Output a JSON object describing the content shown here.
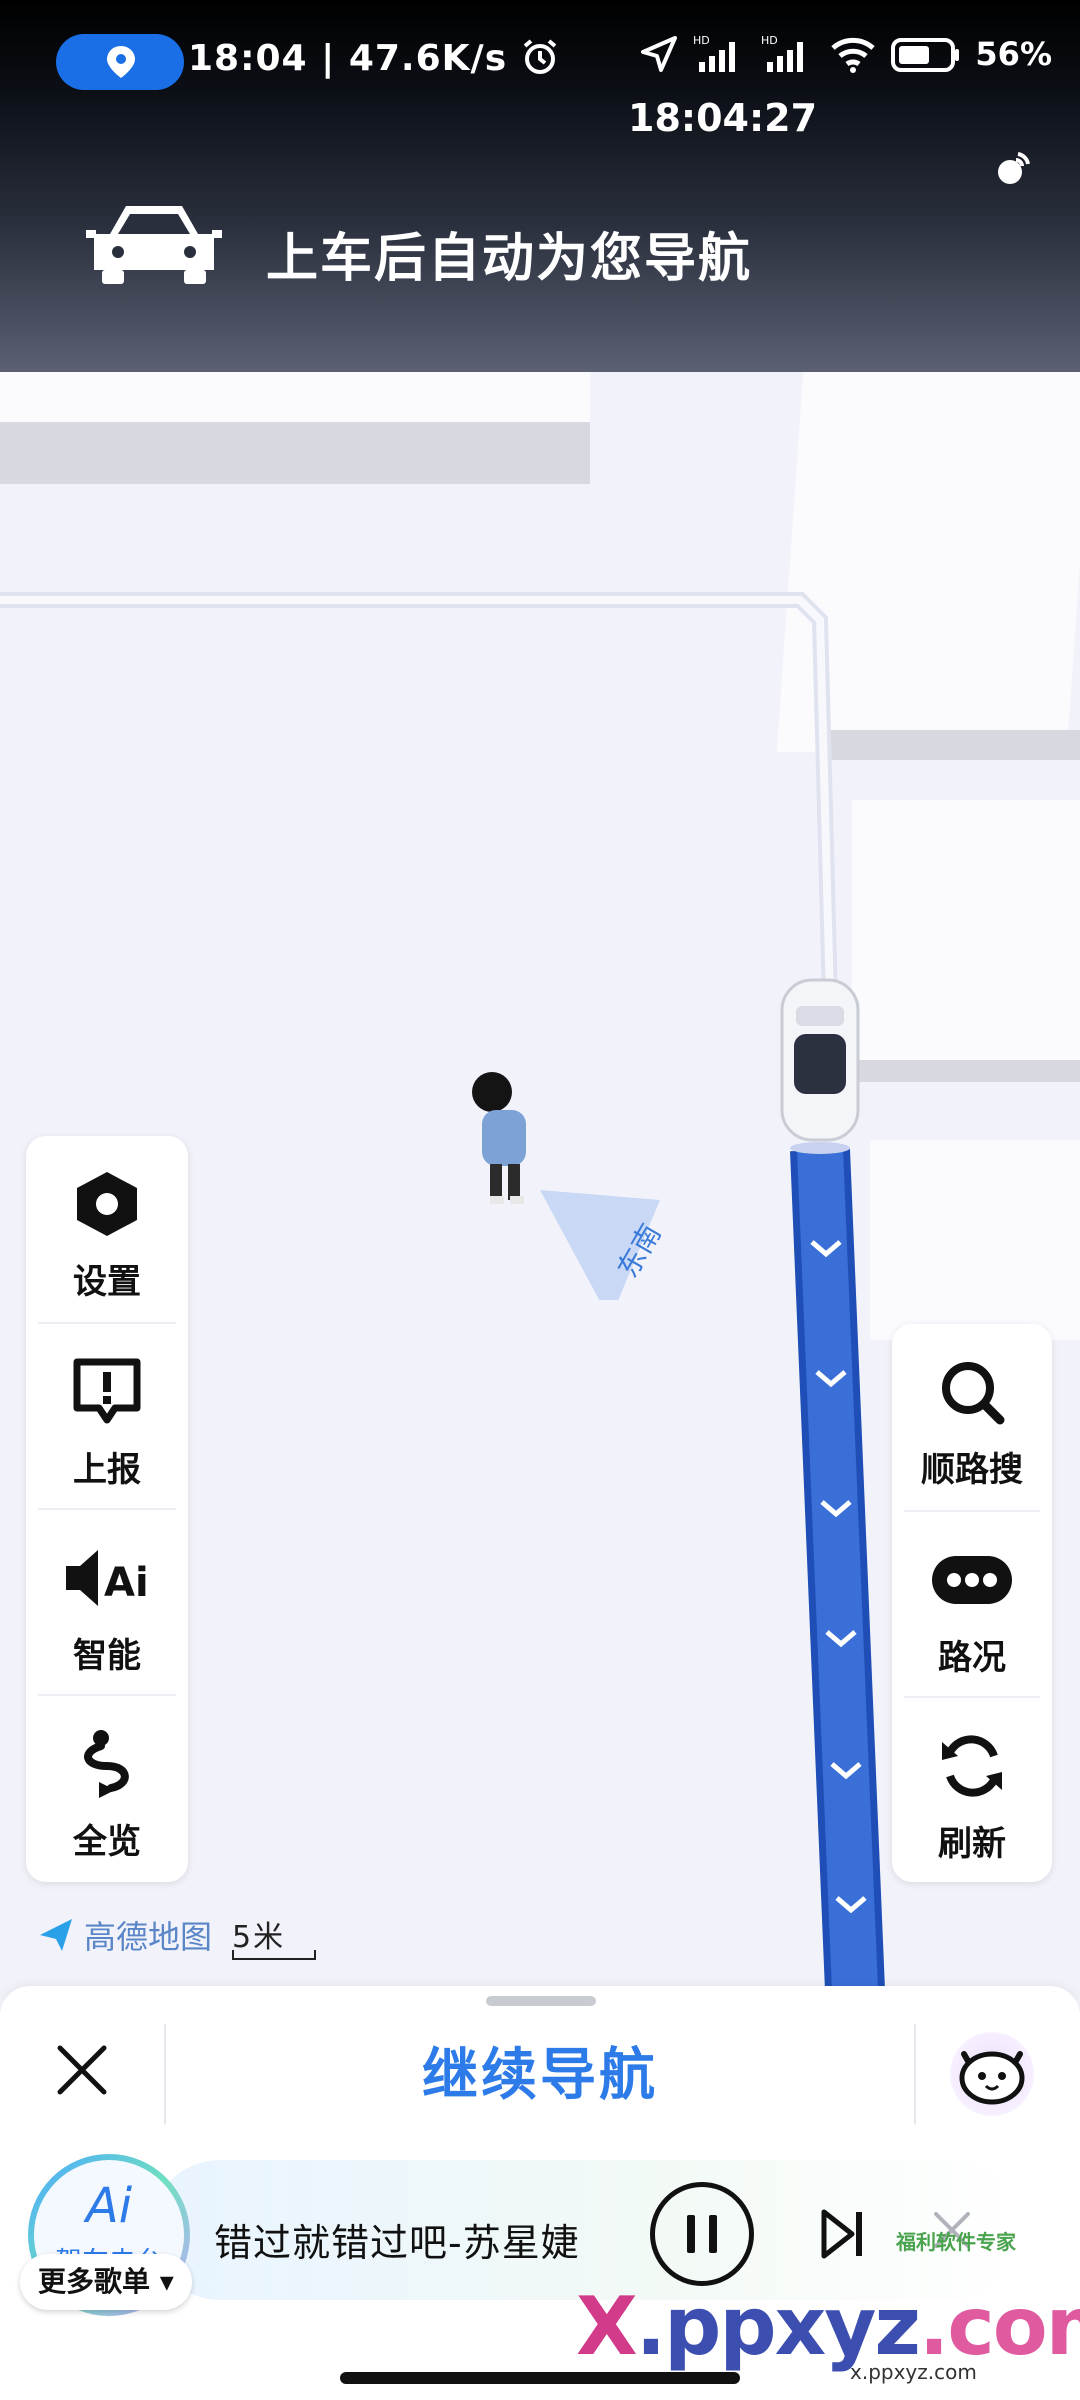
{
  "status_bar": {
    "time": "18:04",
    "speed": "47.6K/s",
    "battery": "56%",
    "network_badges": [
      "HD",
      "HD"
    ],
    "clock_overlay": "18:04:27"
  },
  "header": {
    "title": "上车后自动为您导航"
  },
  "left_panel": [
    {
      "label": "设置",
      "icon": "settings-hexagon-icon"
    },
    {
      "label": "上报",
      "icon": "report-icon"
    },
    {
      "label": "智能",
      "icon": "ai-voice-icon"
    },
    {
      "label": "全览",
      "icon": "overview-route-icon"
    }
  ],
  "right_panel": [
    {
      "label": "顺路搜",
      "icon": "search-icon"
    },
    {
      "label": "路况",
      "icon": "traffic-icon"
    },
    {
      "label": "刷新",
      "icon": "refresh-icon"
    }
  ],
  "map": {
    "direction_label": "东南",
    "brand": "高德地图",
    "scale": "5米"
  },
  "sheet": {
    "continue_label": "继续导航"
  },
  "radio": {
    "logo_text": "Ai",
    "name": "驾车电台",
    "song": "错过就错过吧-苏星婕",
    "playlist_label": "更多歌单"
  },
  "watermark": {
    "text_x": "X",
    "text_rest": ".ppxyz",
    "text_dot": ".com",
    "url": "x.ppxyz.com",
    "badge": "福利软件专家"
  },
  "colors": {
    "accent": "#2d7be8",
    "route": "#3a6fd8",
    "location_pill": "#1a6ee6"
  }
}
